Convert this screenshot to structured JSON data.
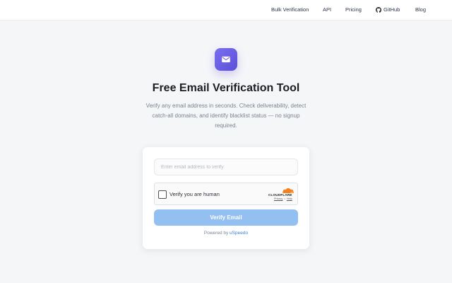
{
  "nav": {
    "items": [
      {
        "label": "Bulk Verification"
      },
      {
        "label": "API"
      },
      {
        "label": "Pricing"
      },
      {
        "label": "GitHub",
        "icon": "github-icon"
      },
      {
        "label": "Blog"
      }
    ]
  },
  "hero": {
    "icon": "mail-icon",
    "title": "Free Email Verification Tool",
    "subtitle": "Verify any email address in seconds. Check deliverability, detect catch-all domains, and identify blacklist status — no signup required."
  },
  "form": {
    "email": {
      "placeholder": "Enter email address to verify",
      "value": ""
    },
    "captcha": {
      "label": "Verify you are human",
      "brand": "CLOUDFLARE",
      "privacy": "Privacy",
      "separator": "•",
      "help": "Help",
      "checked": false
    },
    "submit_label": "Verify Email",
    "powered_prefix": "Powered by",
    "powered_link": "uSpeedo"
  },
  "colors": {
    "accent": "#6a5fe6",
    "button": "#93c0f1",
    "link": "#3a82d6",
    "cloudflare": "#f48120"
  }
}
